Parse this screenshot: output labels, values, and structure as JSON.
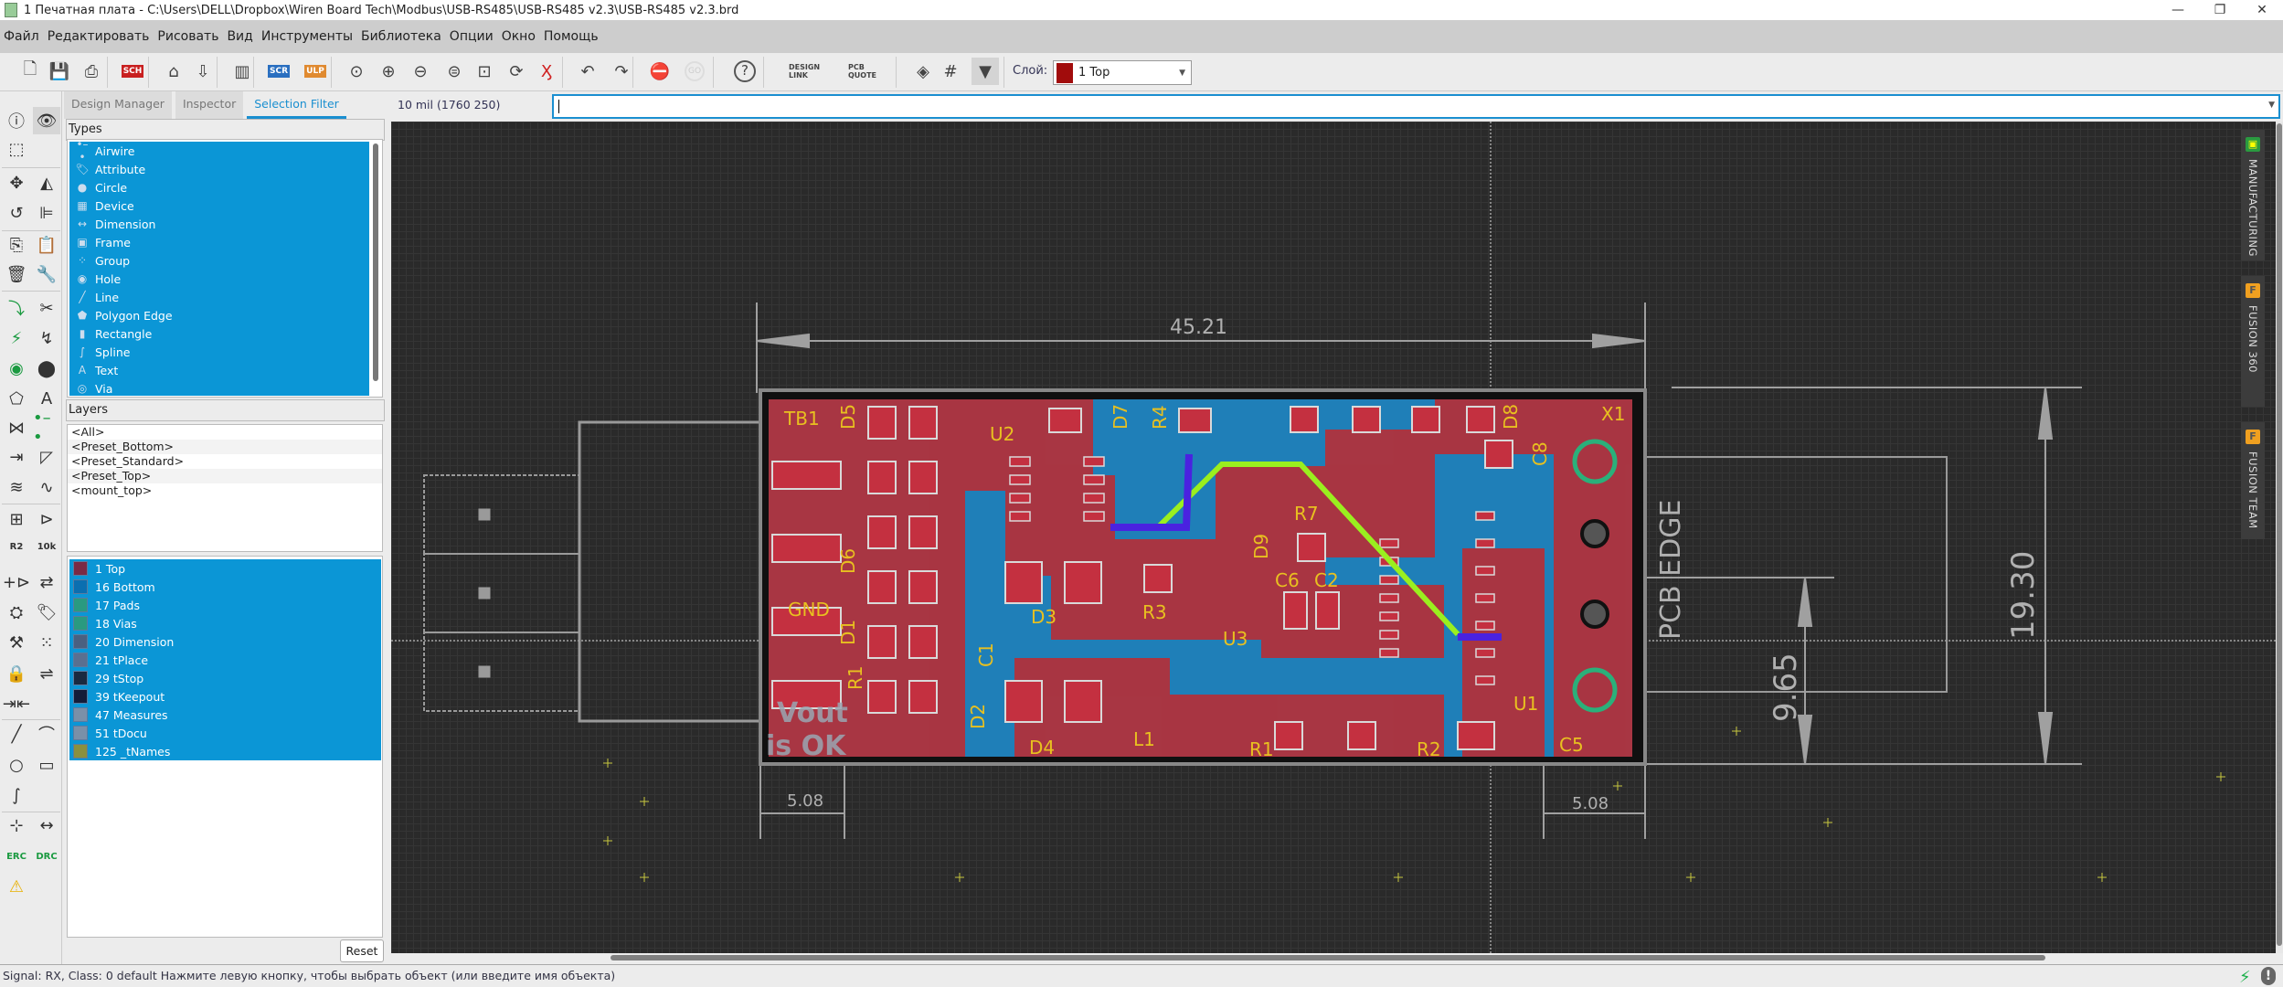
{
  "window": {
    "title": "1 Печатная плата - C:\\Users\\DELL\\Dropbox\\Wiren Board Tech\\Modbus\\USB-RS485\\USB-RS485 v2.3\\USB-RS485 v2.3.brd",
    "minimize": "—",
    "restore": "❐",
    "close": "✕"
  },
  "menu": [
    "Файл",
    "Редактировать",
    "Рисовать",
    "Вид",
    "Инструменты",
    "Библиотека",
    "Опции",
    "Окно",
    "Помощь"
  ],
  "toolbar": {
    "icons": [
      {
        "name": "new-file-icon",
        "glyph": "🗋"
      },
      {
        "name": "save-icon",
        "glyph": "💾"
      },
      {
        "name": "print-icon",
        "glyph": "⎙"
      },
      {
        "name": "sch-brd-switch-icon",
        "glyph": "SCH"
      },
      {
        "name": "cam-processor-icon",
        "glyph": "⌂"
      },
      {
        "name": "manufacturing-export-icon",
        "glyph": "⇩"
      },
      {
        "name": "library-icon",
        "glyph": "▥"
      },
      {
        "name": "script-icon",
        "glyph": "SCR"
      },
      {
        "name": "ulp-icon",
        "glyph": "ULP"
      },
      {
        "name": "zoom-fit-icon",
        "glyph": "⊙"
      },
      {
        "name": "zoom-in-icon",
        "glyph": "⊕"
      },
      {
        "name": "zoom-out-icon",
        "glyph": "⊖"
      },
      {
        "name": "zoom-select-icon",
        "glyph": "⊜"
      },
      {
        "name": "zoom-previous-icon",
        "glyph": "⊡"
      },
      {
        "name": "redraw-icon",
        "glyph": "⟳"
      },
      {
        "name": "ratsnest-icon",
        "glyph": "Ӽ"
      },
      {
        "name": "undo-icon",
        "glyph": "↶"
      },
      {
        "name": "redo-icon",
        "glyph": "↷"
      },
      {
        "name": "stop-icon",
        "glyph": "⛔"
      },
      {
        "name": "go-icon",
        "glyph": "GO"
      },
      {
        "name": "help-icon",
        "glyph": "?"
      },
      {
        "name": "design-link-icon",
        "glyph": "DESIGN LINK"
      },
      {
        "name": "pcb-quote-icon",
        "glyph": "PCB QUOTE"
      },
      {
        "name": "layer-settings-icon",
        "glyph": "◈"
      },
      {
        "name": "grid-icon",
        "glyph": "#"
      },
      {
        "name": "filter-icon",
        "glyph": "▼"
      }
    ],
    "layer_label": "Слой:",
    "layer_value": "1 Top",
    "layer_color": "#a10c0c"
  },
  "panel": {
    "tabs": [
      "Design Manager",
      "Inspector",
      "Selection Filter"
    ],
    "active_tab": "Selection Filter",
    "types_header": "Types",
    "types": [
      {
        "label": "Airwire",
        "icon": "airwire-icon",
        "glyph": "•–•"
      },
      {
        "label": "Attribute",
        "icon": "attribute-icon",
        "glyph": "🏷"
      },
      {
        "label": "Circle",
        "icon": "circle-icon",
        "glyph": "●"
      },
      {
        "label": "Device",
        "icon": "device-icon",
        "glyph": "▦"
      },
      {
        "label": "Dimension",
        "icon": "dimension-icon",
        "glyph": "↔"
      },
      {
        "label": "Frame",
        "icon": "frame-icon",
        "glyph": "▣"
      },
      {
        "label": "Group",
        "icon": "group-icon",
        "glyph": "⁘"
      },
      {
        "label": "Hole",
        "icon": "hole-icon",
        "glyph": "◉"
      },
      {
        "label": "Line",
        "icon": "line-icon",
        "glyph": "╱"
      },
      {
        "label": "Polygon Edge",
        "icon": "polygon-icon",
        "glyph": "⬟"
      },
      {
        "label": "Rectangle",
        "icon": "rectangle-icon",
        "glyph": "▮"
      },
      {
        "label": "Spline",
        "icon": "spline-icon",
        "glyph": "∫"
      },
      {
        "label": "Text",
        "icon": "text-icon",
        "glyph": "A"
      },
      {
        "label": "Via",
        "icon": "via-icon",
        "glyph": "◎"
      }
    ],
    "layers_header": "Layers",
    "layer_presets": [
      "<All>",
      "<Preset_Bottom>",
      "<Preset_Standard>",
      "<Preset_Top>",
      "<mount_top>"
    ],
    "layers": [
      {
        "label": "1 Top",
        "color": "#7a2a45"
      },
      {
        "label": "16 Bottom",
        "color": "#0b6fb0"
      },
      {
        "label": "17 Pads",
        "color": "#2a9a80"
      },
      {
        "label": "18 Vias",
        "color": "#2a9a80"
      },
      {
        "label": "20 Dimension",
        "color": "#4a6080"
      },
      {
        "label": "21 tPlace",
        "color": "#5a7090"
      },
      {
        "label": "29 tStop",
        "color": "#1a2a40"
      },
      {
        "label": "39 tKeepout",
        "color": "#141c38"
      },
      {
        "label": "47 Measures",
        "color": "#7a90a8"
      },
      {
        "label": "51 tDocu",
        "color": "#7a90a8"
      },
      {
        "label": "125 _tNames",
        "color": "#8a9040"
      }
    ],
    "reset_label": "Reset"
  },
  "left_tools": [
    [
      "info-icon",
      "ⓘ"
    ],
    [
      "show-icon",
      "👁"
    ],
    [
      "group-select-icon",
      "⬚"
    ],
    [
      "",
      ""
    ],
    [
      "move-icon",
      "✥"
    ],
    [
      "mirror-icon",
      "◭"
    ],
    [
      "rotate-icon",
      "↺"
    ],
    [
      "align-icon",
      "⊫"
    ],
    [
      "copy-icon",
      "⎘"
    ],
    [
      "paste-icon",
      "📋"
    ],
    [
      "delete-icon",
      "🗑"
    ],
    [
      "wrench-icon",
      "🔧"
    ],
    [
      "route-icon",
      "⤵"
    ],
    [
      "ripup-icon",
      "✂"
    ],
    [
      "autorouter-icon",
      "⚡"
    ],
    [
      "optimize-icon",
      "↯"
    ],
    [
      "via-tool-icon",
      "◉"
    ],
    [
      "hole-tool-icon",
      "⬤"
    ],
    [
      "polygon-tool-icon",
      "⬠"
    ],
    [
      "text-tool-icon",
      "A"
    ],
    [
      "signal-icon",
      "⋈"
    ],
    [
      "airwire-tool-icon",
      "•–•"
    ],
    [
      "swap-icon",
      "⇥"
    ],
    [
      "miter-icon",
      "◸"
    ],
    [
      "meander-list-icon",
      "≋"
    ],
    [
      "meander-icon",
      "∿"
    ],
    [
      "add-part-icon",
      "⊞"
    ],
    [
      "add-gate-icon",
      "⊳"
    ],
    [
      "name-icon",
      "R2"
    ],
    [
      "value-icon",
      "10k"
    ],
    [
      "add-icon",
      "+⊳"
    ],
    [
      "replace-icon",
      "⇄"
    ],
    [
      "smash-icon",
      "⛭"
    ],
    [
      "attribute-tool-icon",
      "🏷"
    ],
    [
      "paint-icon",
      "⚒"
    ],
    [
      "group-icon",
      "⁙"
    ],
    [
      "lock-icon",
      "🔒"
    ],
    [
      "pinswap-icon",
      "⇌"
    ],
    [
      "split-icon",
      "⇥⇤"
    ],
    [
      "",
      ""
    ],
    [
      "line-tool-icon",
      "╱"
    ],
    [
      "arc-tool-icon",
      "⌒"
    ],
    [
      "circle-tool-icon",
      "○"
    ],
    [
      "rect-tool-icon",
      "▭"
    ],
    [
      "spline-tool-icon",
      "∫"
    ],
    [
      "",
      ""
    ],
    [
      "mark-icon",
      "⊹"
    ],
    [
      "dimension-tool-icon",
      "↔"
    ],
    [
      "erc-icon",
      "ERC"
    ],
    [
      "drc-icon",
      "DRC"
    ],
    [
      "warning-icon",
      "⚠"
    ],
    [
      "",
      ""
    ]
  ],
  "coord_readout": "10 mil (1760 250)",
  "command_input": {
    "value": "",
    "placeholder": ""
  },
  "side_tabs": [
    {
      "label": "MANUFACTURING",
      "badge": "▣",
      "badge_color": "#2a9a40"
    },
    {
      "label": "FUSION 360",
      "badge": "F",
      "badge_color": "#f0a020"
    },
    {
      "label": "FUSION TEAM",
      "badge": "F",
      "badge_color": "#f0a020"
    }
  ],
  "board": {
    "dimensions": {
      "width": "45.21",
      "height": "19.30",
      "half_height": "9.65",
      "left_offset": "5.08",
      "right_offset": "5.08"
    },
    "edge_label": "PCB EDGE",
    "silk_text": [
      "Vout",
      "is OK"
    ],
    "components": [
      "TB1",
      "D5",
      "U2",
      "D7",
      "R4",
      "D8",
      "X1",
      "C8",
      "R7",
      "D9",
      "C6",
      "C2",
      "R3",
      "D3",
      "D6",
      "GND",
      "D1",
      "U3",
      "C1",
      "R1",
      "D2",
      "D4",
      "L1",
      "R1",
      "R2",
      "C5",
      "U1"
    ],
    "colors": {
      "top": "#b3303a",
      "bottom": "#1f7fb8",
      "pads": "#c43040",
      "label": "#e8c020",
      "route": "#9aef1f",
      "bottom_route": "#4a22e0",
      "dimension": "#a0a0a0"
    }
  },
  "status": {
    "text": "Signal: RX, Class: 0 default Нажмите левую кнопку, чтобы выбрать объект (или введите имя объекта)",
    "ok_icon": "lightning-icon",
    "warn_icon": "exclamation-icon"
  }
}
